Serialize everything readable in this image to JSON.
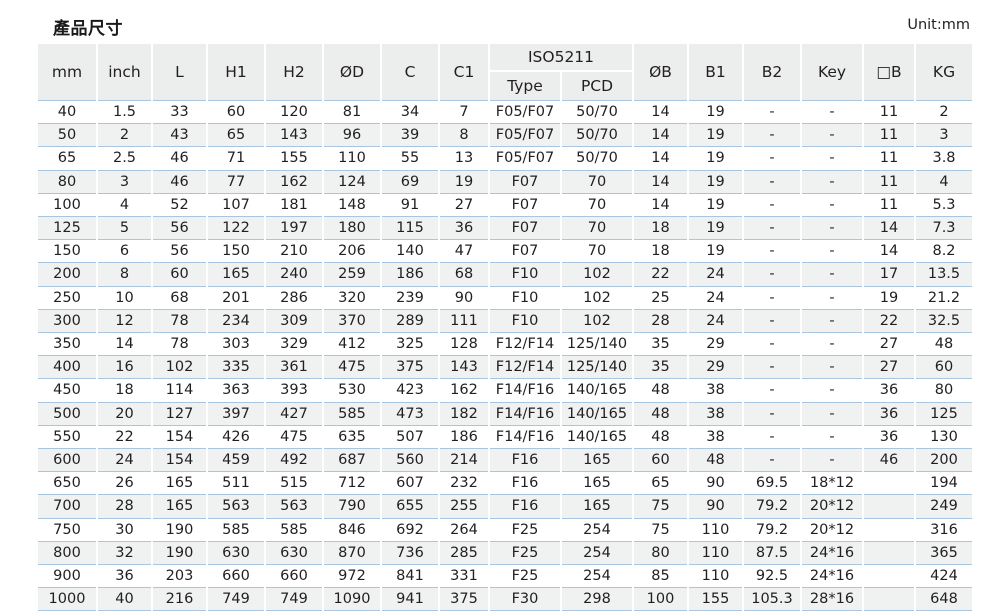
{
  "document": {
    "title": "產品尺寸",
    "unit_label": "Unit:mm",
    "accent_line_color": "#a8c6df",
    "header_bg_color": "#eceded",
    "stripe_color": "#f0f1f1",
    "text_color": "#231f20"
  },
  "table": {
    "group_header": {
      "iso_label": "ISO5211"
    },
    "columns": [
      {
        "key": "mm",
        "label": "mm"
      },
      {
        "key": "inch",
        "label": "inch"
      },
      {
        "key": "L",
        "label": "L"
      },
      {
        "key": "H1",
        "label": "H1"
      },
      {
        "key": "H2",
        "label": "H2"
      },
      {
        "key": "OD",
        "label": "ØD"
      },
      {
        "key": "C",
        "label": "C"
      },
      {
        "key": "C1",
        "label": "C1"
      },
      {
        "key": "Type",
        "label": "Type"
      },
      {
        "key": "PCD",
        "label": "PCD"
      },
      {
        "key": "OB",
        "label": "ØB"
      },
      {
        "key": "B1",
        "label": "B1"
      },
      {
        "key": "B2",
        "label": "B2"
      },
      {
        "key": "Key",
        "label": "Key"
      },
      {
        "key": "SqB",
        "label": "□B"
      },
      {
        "key": "KG",
        "label": "KG"
      }
    ],
    "rows": [
      [
        "40",
        "1.5",
        "33",
        "60",
        "120",
        "81",
        "34",
        "7",
        "F05/F07",
        "50/70",
        "14",
        "19",
        "-",
        "-",
        "11",
        "2"
      ],
      [
        "50",
        "2",
        "43",
        "65",
        "143",
        "96",
        "39",
        "8",
        "F05/F07",
        "50/70",
        "14",
        "19",
        "-",
        "-",
        "11",
        "3"
      ],
      [
        "65",
        "2.5",
        "46",
        "71",
        "155",
        "110",
        "55",
        "13",
        "F05/F07",
        "50/70",
        "14",
        "19",
        "-",
        "-",
        "11",
        "3.8"
      ],
      [
        "80",
        "3",
        "46",
        "77",
        "162",
        "124",
        "69",
        "19",
        "F07",
        "70",
        "14",
        "19",
        "-",
        "-",
        "11",
        "4"
      ],
      [
        "100",
        "4",
        "52",
        "107",
        "181",
        "148",
        "91",
        "27",
        "F07",
        "70",
        "14",
        "19",
        "-",
        "-",
        "11",
        "5.3"
      ],
      [
        "125",
        "5",
        "56",
        "122",
        "197",
        "180",
        "115",
        "36",
        "F07",
        "70",
        "18",
        "19",
        "-",
        "-",
        "14",
        "7.3"
      ],
      [
        "150",
        "6",
        "56",
        "150",
        "210",
        "206",
        "140",
        "47",
        "F07",
        "70",
        "18",
        "19",
        "-",
        "-",
        "14",
        "8.2"
      ],
      [
        "200",
        "8",
        "60",
        "165",
        "240",
        "259",
        "186",
        "68",
        "F10",
        "102",
        "22",
        "24",
        "-",
        "-",
        "17",
        "13.5"
      ],
      [
        "250",
        "10",
        "68",
        "201",
        "286",
        "320",
        "239",
        "90",
        "F10",
        "102",
        "25",
        "24",
        "-",
        "-",
        "19",
        "21.2"
      ],
      [
        "300",
        "12",
        "78",
        "234",
        "309",
        "370",
        "289",
        "111",
        "F10",
        "102",
        "28",
        "24",
        "-",
        "-",
        "22",
        "32.5"
      ],
      [
        "350",
        "14",
        "78",
        "303",
        "329",
        "412",
        "325",
        "128",
        "F12/F14",
        "125/140",
        "35",
        "29",
        "-",
        "-",
        "27",
        "48"
      ],
      [
        "400",
        "16",
        "102",
        "335",
        "361",
        "475",
        "375",
        "143",
        "F12/F14",
        "125/140",
        "35",
        "29",
        "-",
        "-",
        "27",
        "60"
      ],
      [
        "450",
        "18",
        "114",
        "363",
        "393",
        "530",
        "423",
        "162",
        "F14/F16",
        "140/165",
        "48",
        "38",
        "-",
        "-",
        "36",
        "80"
      ],
      [
        "500",
        "20",
        "127",
        "397",
        "427",
        "585",
        "473",
        "182",
        "F14/F16",
        "140/165",
        "48",
        "38",
        "-",
        "-",
        "36",
        "125"
      ],
      [
        "550",
        "22",
        "154",
        "426",
        "475",
        "635",
        "507",
        "186",
        "F14/F16",
        "140/165",
        "48",
        "38",
        "-",
        "-",
        "36",
        "130"
      ],
      [
        "600",
        "24",
        "154",
        "459",
        "492",
        "687",
        "560",
        "214",
        "F16",
        "165",
        "60",
        "48",
        "-",
        "-",
        "46",
        "200"
      ],
      [
        "650",
        "26",
        "165",
        "511",
        "515",
        "712",
        "607",
        "232",
        "F16",
        "165",
        "65",
        "90",
        "69.5",
        "18*12",
        "",
        "194"
      ],
      [
        "700",
        "28",
        "165",
        "563",
        "563",
        "790",
        "655",
        "255",
        "F16",
        "165",
        "75",
        "90",
        "79.2",
        "20*12",
        "",
        "249"
      ],
      [
        "750",
        "30",
        "190",
        "585",
        "585",
        "846",
        "692",
        "264",
        "F25",
        "254",
        "75",
        "110",
        "79.2",
        "20*12",
        "",
        "316"
      ],
      [
        "800",
        "32",
        "190",
        "630",
        "630",
        "870",
        "736",
        "285",
        "F25",
        "254",
        "80",
        "110",
        "87.5",
        "24*16",
        "",
        "365"
      ],
      [
        "900",
        "36",
        "203",
        "660",
        "660",
        "972",
        "841",
        "331",
        "F25",
        "254",
        "85",
        "110",
        "92.5",
        "24*16",
        "",
        "424"
      ],
      [
        "1000",
        "40",
        "216",
        "749",
        "749",
        "1090",
        "941",
        "375",
        "F30",
        "298",
        "100",
        "155",
        "105.3",
        "28*16",
        "",
        "648"
      ]
    ]
  }
}
